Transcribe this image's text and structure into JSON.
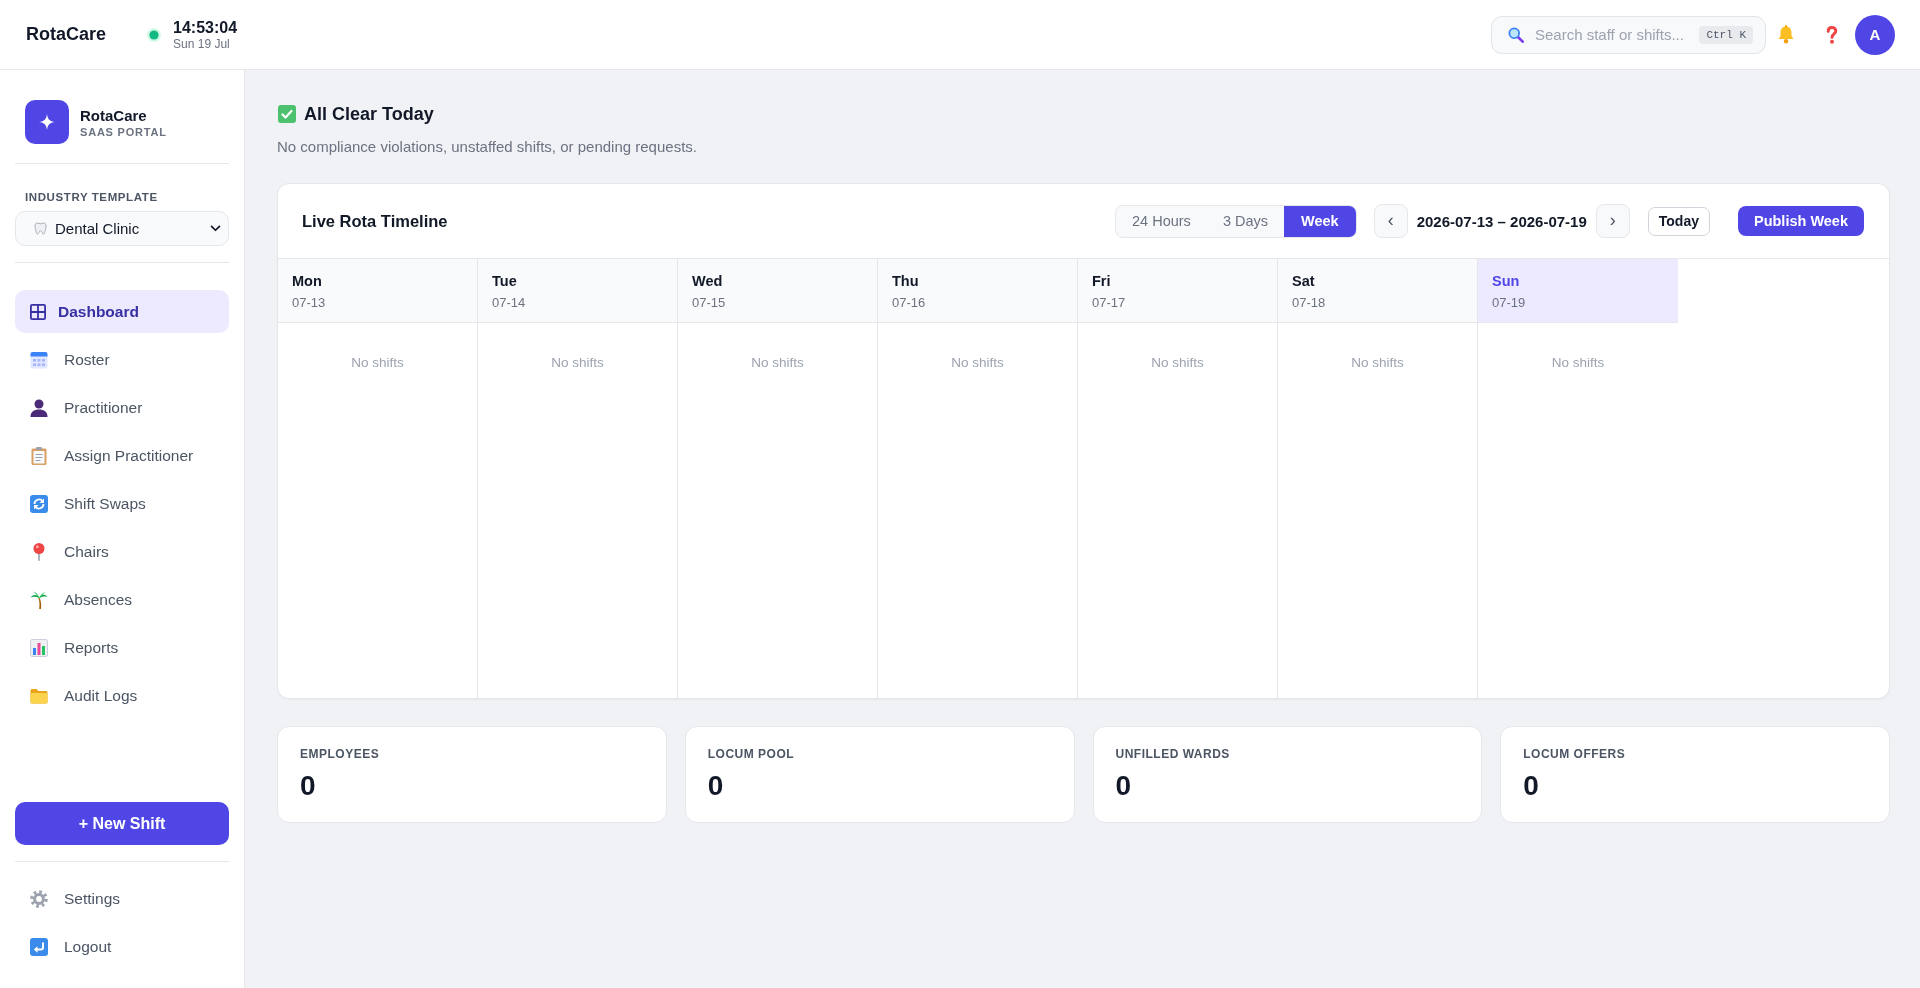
{
  "top_bar": {
    "logo": "RotaCare",
    "clock": {
      "live": true,
      "time": "14:53:04",
      "date": "Sun 19 Jul"
    },
    "search": {
      "placeholder": "Search staff or shifts...",
      "shortcut": "Ctrl K"
    },
    "avatar": "A"
  },
  "sidebar": {
    "brand": {
      "name": "RotaCare",
      "tagline": "SAAS PORTAL"
    },
    "industry_template": {
      "label": "INDUSTRY TEMPLATE",
      "value": "Dental Clinic"
    },
    "nav": [
      {
        "label": "Dashboard",
        "selected": true
      },
      {
        "label": "Roster",
        "selected": false
      },
      {
        "label": "Practitioner",
        "selected": false
      },
      {
        "label": "Assign Practitioner",
        "selected": false
      },
      {
        "label": "Shift Swaps",
        "selected": false
      },
      {
        "label": "Chairs",
        "selected": false
      },
      {
        "label": "Absences",
        "selected": false
      },
      {
        "label": "Reports",
        "selected": false
      },
      {
        "label": "Audit Logs",
        "selected": false
      }
    ],
    "new_shift_button": "+ New Shift",
    "footer_nav": [
      {
        "label": "Settings",
        "selected": false
      },
      {
        "label": "Logout",
        "selected": false
      }
    ]
  },
  "alert": {
    "title": "All Clear Today",
    "message": "No compliance violations, unstaffed shifts, or pending requests."
  },
  "timeline": {
    "title": "Live Rota Timeline",
    "views": [
      {
        "label": "24 Hours",
        "selected": false
      },
      {
        "label": "3 Days",
        "selected": false
      },
      {
        "label": "Week",
        "selected": true
      }
    ],
    "prev_button": "‹",
    "range": "2026-07-13 – 2026-07-19",
    "next_button": "›",
    "today_button": "Today",
    "publish_button": "Publish Week",
    "days": [
      {
        "name": "Mon",
        "date": "07-13",
        "today": false,
        "empty_text": "No shifts"
      },
      {
        "name": "Tue",
        "date": "07-14",
        "today": false,
        "empty_text": "No shifts"
      },
      {
        "name": "Wed",
        "date": "07-15",
        "today": false,
        "empty_text": "No shifts"
      },
      {
        "name": "Thu",
        "date": "07-16",
        "today": false,
        "empty_text": "No shifts"
      },
      {
        "name": "Fri",
        "date": "07-17",
        "today": false,
        "empty_text": "No shifts"
      },
      {
        "name": "Sat",
        "date": "07-18",
        "today": false,
        "empty_text": "No shifts"
      },
      {
        "name": "Sun",
        "date": "07-19",
        "today": true,
        "empty_text": "No shifts"
      }
    ]
  },
  "stats": [
    {
      "label": "EMPLOYEES",
      "value": "0"
    },
    {
      "label": "LOCUM POOL",
      "value": "0"
    },
    {
      "label": "UNFILLED WARDS",
      "value": "0"
    },
    {
      "label": "LOCUM OFFERS",
      "value": "0"
    }
  ]
}
